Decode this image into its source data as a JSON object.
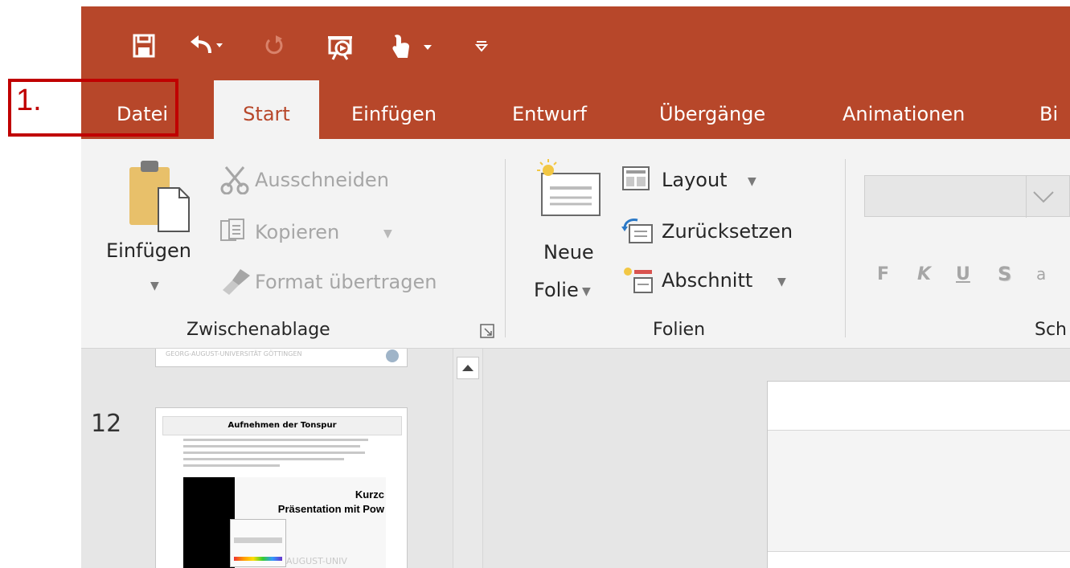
{
  "tabs": {
    "datei": "Datei",
    "start": "Start",
    "einfuegen": "Einfügen",
    "entwurf": "Entwurf",
    "uebergaenge": "Übergänge",
    "animationen": "Animationen",
    "partial": "Bi"
  },
  "clipboard": {
    "paste_label": "Einfügen",
    "cut_label": "Ausschneiden",
    "copy_label": "Kopieren",
    "format_painter_label": "Format übertragen",
    "group_label": "Zwischenablage"
  },
  "slides_group": {
    "new_slide_line1": "Neue",
    "new_slide_line2": "Folie",
    "layout_label": "Layout",
    "reset_label": "Zurücksetzen",
    "section_label": "Abschnitt",
    "group_label": "Folien"
  },
  "font_group": {
    "bold": "F",
    "italic": "K",
    "underline": "U",
    "shadow": "S",
    "more": "a",
    "group_label_partial": "Sch"
  },
  "thumbnails": {
    "slide_number": "12",
    "slide_title": "Aufnehmen der Tonspur",
    "prev_footer": "GEORG-AUGUST-UNIVERSITÄT GÖTTINGEN",
    "overlay_title_1": "Kurzc",
    "overlay_title_2": "Präsentation mit Pow",
    "overlay_footer": "AUGUST-UNIV"
  },
  "annotation": {
    "step": "1."
  },
  "colors": {
    "accent": "#b7472a",
    "annotation": "#c00000",
    "ribbon_bg": "#f3f3f3"
  }
}
